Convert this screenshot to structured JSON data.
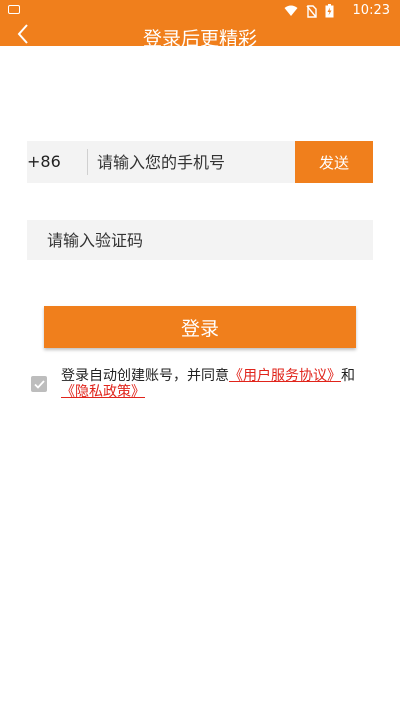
{
  "status_bar": {
    "time": "10:23"
  },
  "header": {
    "title": "登录后更精彩"
  },
  "phone": {
    "prefix": "+86",
    "placeholder": "请输入您的手机号",
    "send_label": "发送"
  },
  "code": {
    "placeholder": "请输入验证码"
  },
  "login": {
    "label": "登录"
  },
  "agreement": {
    "text": "登录自动创建账号，并同意",
    "user_agreement": "《用户服务协议》",
    "and": "和",
    "privacy_policy": "《隐私政策》",
    "checked": true
  },
  "colors": {
    "accent": "#f07f1c",
    "link": "#e0241b",
    "field_bg": "#f3f3f3"
  }
}
